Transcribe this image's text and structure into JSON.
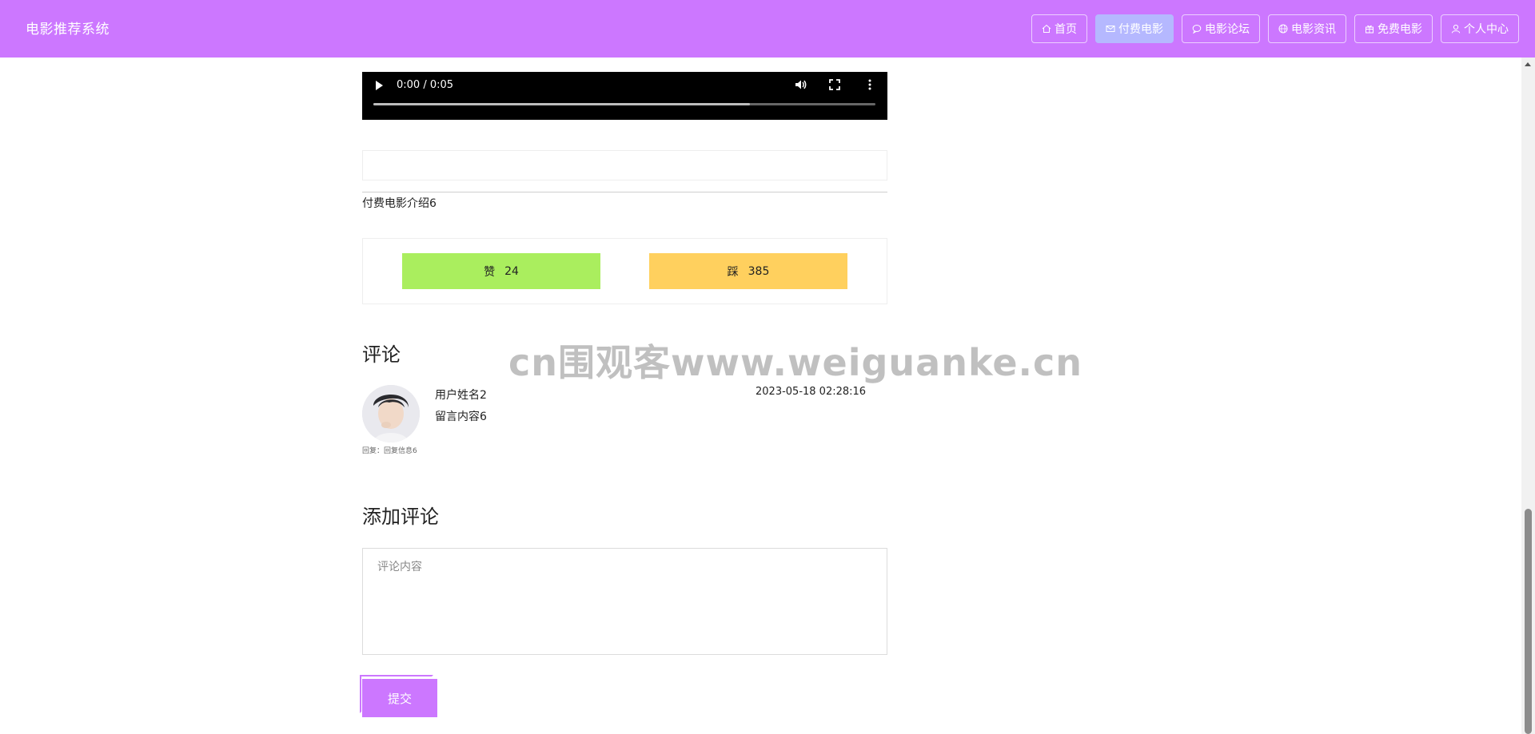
{
  "header": {
    "brand": "电影推荐系统",
    "nav": [
      {
        "label": "首页",
        "icon": "home-icon",
        "active": false
      },
      {
        "label": "付费电影",
        "icon": "mail-icon",
        "active": true
      },
      {
        "label": "电影论坛",
        "icon": "chat-icon",
        "active": false
      },
      {
        "label": "电影资讯",
        "icon": "globe-icon",
        "active": false
      },
      {
        "label": "免费电影",
        "icon": "gift-icon",
        "active": false
      },
      {
        "label": "个人中心",
        "icon": "user-icon",
        "active": false
      }
    ],
    "colors": {
      "bar": "#cc77ff",
      "active_item": "#b5b8ff"
    }
  },
  "video": {
    "time": "0:00 / 0:05",
    "buffered_fraction": 0.75
  },
  "movie": {
    "intro": "付费电影介绍6"
  },
  "vote": {
    "like_label": "赞",
    "like_count": "24",
    "dislike_label": "踩",
    "dislike_count": "385",
    "colors": {
      "like": "#aaee5e",
      "dislike": "#ffd05e"
    }
  },
  "comments": {
    "title": "评论",
    "items": [
      {
        "user": "用户姓名2",
        "time": "2023-05-18 02:28:16",
        "content": "留言内容6",
        "reply": "回复：回复信息6"
      }
    ]
  },
  "add_comment": {
    "title": "添加评论",
    "placeholder": "评论内容",
    "value": "",
    "submit_label": "提交"
  },
  "watermark": {
    "text": "cn围观客www.weiguanke.cn"
  }
}
